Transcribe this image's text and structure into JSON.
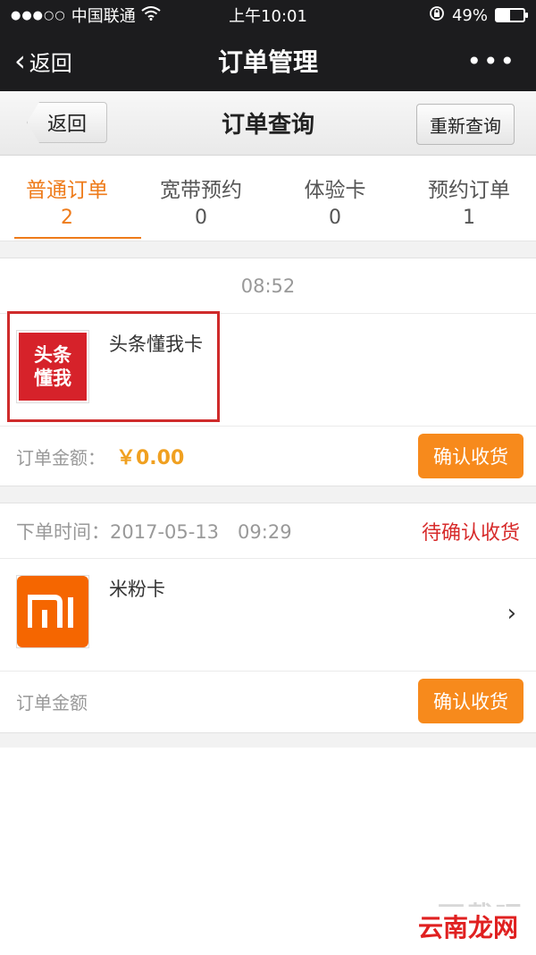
{
  "status_bar": {
    "carrier": "中国联通",
    "time": "上午10:01",
    "battery_text": "49%",
    "battery_level": 0.49
  },
  "nav": {
    "back_label": "返回",
    "title": "订单管理"
  },
  "sub_header": {
    "back_label": "返回",
    "title": "订单查询",
    "requery_label": "重新查询"
  },
  "tabs": [
    {
      "label": "普通订单",
      "count": "2"
    },
    {
      "label": "宽带预约",
      "count": "0"
    },
    {
      "label": "体验卡",
      "count": "0"
    },
    {
      "label": "预约订单",
      "count": "1"
    }
  ],
  "orders": [
    {
      "time_text": "08:52",
      "product_name": "头条懂我卡",
      "logo_text": "头条懂我",
      "amount_label": "订单金额：",
      "amount_value": "￥0.00",
      "action_label": "确认收货"
    },
    {
      "time_label": "下单时间：",
      "time_value": "2017-05-13　09:29",
      "status": "待确认收货",
      "product_name": "米粉卡",
      "amount_label": "订单金额",
      "action_label": "确认收货"
    }
  ],
  "watermark": {
    "top_text": "下载吧",
    "bottom_text": "云南龙网"
  },
  "colors": {
    "accent": "#ee7b1a",
    "button": "#f78a1c",
    "status_red": "#d72b2b",
    "highlight_box": "#cf2b2b",
    "toutiao_red": "#d6222a",
    "mi_orange": "#f56600"
  }
}
